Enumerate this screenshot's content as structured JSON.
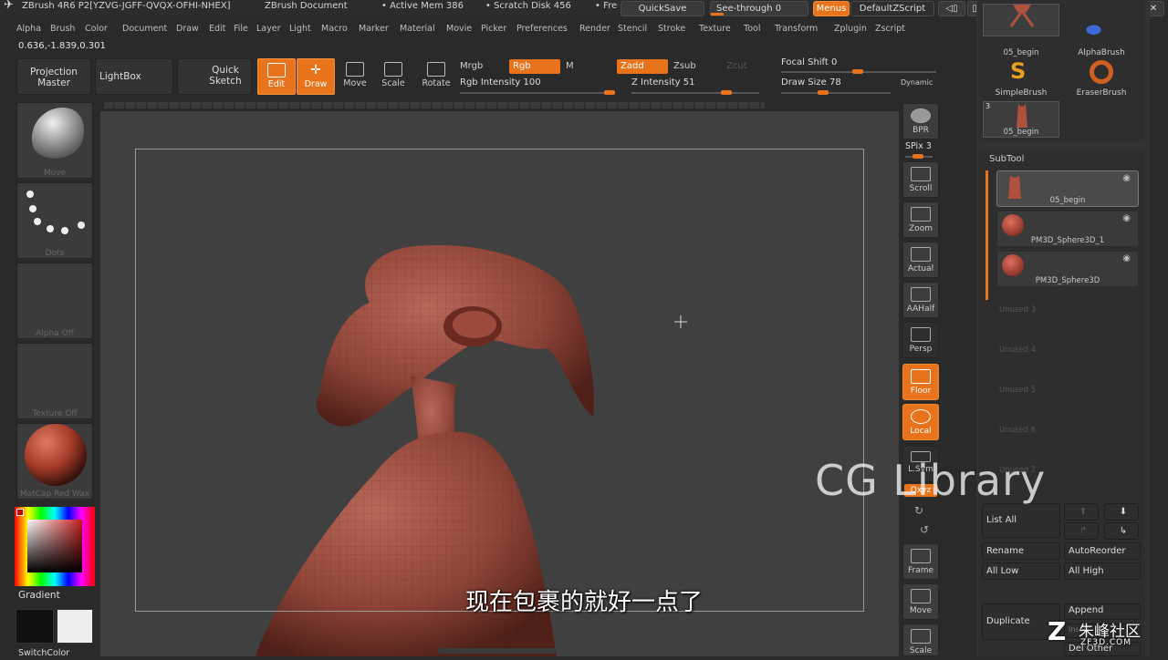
{
  "title": {
    "app": "ZBrush 4R6 P2[YZVG-JGFF-QVQX-OFHI-NHEX]",
    "doc": "ZBrush Document",
    "mem": "• Active Mem 386",
    "scratch": "• Scratch Disk 456",
    "free": "• Fre",
    "quicksave": "QuickSave",
    "seethrough": "See-through",
    "seethrough_val": "0",
    "menus": "Menus",
    "zscript": "DefaultZScript"
  },
  "menu": [
    "Alpha",
    "Brush",
    "Color",
    "Document",
    "Draw",
    "Edit",
    "File",
    "Layer",
    "Light",
    "Macro",
    "Marker",
    "Material",
    "Movie",
    "Picker",
    "Preferences",
    "Render",
    "Stencil",
    "Stroke",
    "Texture",
    "Tool",
    "Transform",
    "Zplugin",
    "Zscript"
  ],
  "coords": "0.636,-1.839,0.301",
  "toolbar": {
    "projection": "Projection Master",
    "lightbox": "LightBox",
    "quicksketch": "Quick Sketch",
    "edit": "Edit",
    "draw": "Draw",
    "move": "Move",
    "scale": "Scale",
    "rotate": "Rotate",
    "mrgb": "Mrgb",
    "rgb": "Rgb",
    "m": "M",
    "zadd": "Zadd",
    "zsub": "Zsub",
    "zcut": "Zcut",
    "rgb_intensity": "Rgb Intensity",
    "rgb_intensity_val": "100",
    "z_intensity": "Z Intensity",
    "z_intensity_val": "51",
    "focal_shift": "Focal Shift",
    "focal_shift_val": "0",
    "draw_size": "Draw Size",
    "draw_size_val": "78",
    "dynamic": "Dynamic"
  },
  "left": {
    "move": "Move",
    "dots": "Dots",
    "alpha": "Alpha Off",
    "texture": "Texture Off",
    "matcap": "MatCap Red Wax",
    "gradient": "Gradient",
    "switchcolor": "SwitchColor"
  },
  "right": {
    "bpr": "BPR",
    "spix": "SPix",
    "spix_val": "3",
    "scroll": "Scroll",
    "zoom": "Zoom",
    "actual": "Actual",
    "aahalf": "AAHalf",
    "persp": "Persp",
    "floor": "Floor",
    "local": "Local",
    "lsym": "L.Sym",
    "xyz": "Qxyz",
    "frame": "Frame",
    "move": "Move",
    "scale": "Scale"
  },
  "panel": {
    "brushes": [
      {
        "name": "05_begin"
      },
      {
        "name": "AlphaBrush"
      },
      {
        "name": "SimpleBrush"
      },
      {
        "name": "EraserBrush"
      },
      {
        "name": "05_begin",
        "count": "3"
      }
    ],
    "subtool_title": "SubTool",
    "subtools": [
      "05_begin",
      "PM3D_Sphere3D_1",
      "PM3D_Sphere3D"
    ],
    "unused": [
      "Unused 3",
      "Unused 4",
      "Unused 5",
      "Unused 6",
      "Unused 7"
    ],
    "list_all": "List All",
    "rename": "Rename",
    "autoreorder": "AutoReorder",
    "all_low": "All Low",
    "all_high": "All High",
    "duplicate": "Duplicate",
    "append": "Append",
    "insert": "Insert",
    "del_other": "Del Other"
  },
  "subtitle": "现在包裹的就好一点了",
  "watermark": "CG Library",
  "logo": "朱峰社区",
  "logo_url": "ZF3D.COM"
}
